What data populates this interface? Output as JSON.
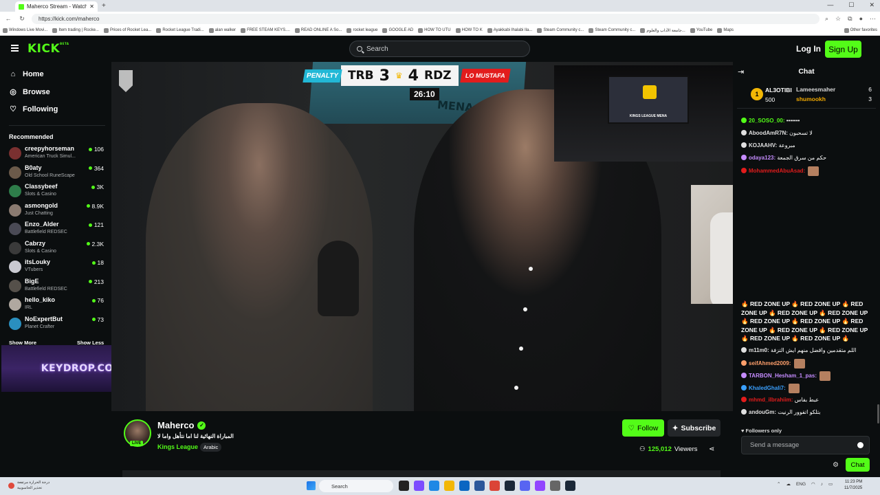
{
  "browser": {
    "tab_title": "Maherco Stream - Watch Li...",
    "url": "https://kick.com/maherco",
    "bookmarks": [
      "Windows Live Movi...",
      "Item trading | Rocke...",
      "Prices of Rocket Lea...",
      "Rocket League Tradi...",
      "alan walker",
      "FREE STEAM KEYS....",
      "READ ONLINE A So...",
      "rocket league",
      "GOOGLE AD",
      "HOW TO UTU",
      "HOW TO K",
      "Ayakkabi Ihalabi Ila...",
      "Steam Community c...",
      "Steam Community c...",
      "جامعة الآداب والعلوم...",
      "YouTube",
      "Maps"
    ],
    "other_bookmarks": "Other favorites"
  },
  "header": {
    "logo": "KICK",
    "logo_tag": "BETA",
    "search_placeholder": "Search",
    "login": "Log In",
    "signup": "Sign Up"
  },
  "sidebar": {
    "nav": [
      {
        "label": "Home",
        "icon": "home-icon"
      },
      {
        "label": "Browse",
        "icon": "compass-icon"
      },
      {
        "label": "Following",
        "icon": "heart-icon"
      }
    ],
    "recommended_title": "Recommended",
    "channels": [
      {
        "name": "creepyhorseman",
        "category": "American Truck Simul...",
        "viewers": "106",
        "color": "#7a3030"
      },
      {
        "name": "B0aty",
        "category": "Old School RuneScape",
        "viewers": "364",
        "color": "#6b5a4a"
      },
      {
        "name": "Classybeef",
        "category": "Slots & Casino",
        "viewers": "3K",
        "color": "#2e7d4a"
      },
      {
        "name": "asmongold",
        "category": "Just Chatting",
        "viewers": "8.9K",
        "color": "#8a7a70"
      },
      {
        "name": "Enzo_Alder",
        "category": "Battlefield REDSEC",
        "viewers": "121",
        "color": "#4a4a55"
      },
      {
        "name": "Cabrzy",
        "category": "Slots & Casino",
        "viewers": "2.3K",
        "color": "#3a3a3a"
      },
      {
        "name": "itsLouky",
        "category": "VTubers",
        "viewers": "18",
        "color": "#c9c9d1"
      },
      {
        "name": "BigE",
        "category": "Battlefield REDSEC",
        "viewers": "213",
        "color": "#55504a"
      },
      {
        "name": "hello_kiko",
        "category": "IRL",
        "viewers": "76",
        "color": "#b0a8a0"
      },
      {
        "name": "NoExpertBut",
        "category": "Planet Crafter",
        "viewers": "73",
        "color": "#2a8fbf"
      }
    ],
    "show_more": "Show More",
    "show_less": "Show Less",
    "ad_text": "KEYDROP.COM"
  },
  "video": {
    "penalty": "PENALTY",
    "team1": "TRB",
    "score1": "3",
    "score2": "4",
    "team2": "RDZ",
    "player_tag": "LO MUSTAFA",
    "clock": "26:10",
    "mena": "MENA",
    "pip_text": "KINGS LEAGUE MENA"
  },
  "stream": {
    "name": "Maherco",
    "live": "LIVE",
    "title": "المباراة النهائية لنا اما نتأهل واما لا",
    "category": "Kings League",
    "language": "Arabic",
    "follow": "Follow",
    "subscribe": "Subscribe",
    "viewers_count": "125,012",
    "viewers_label": "Viewers"
  },
  "chat": {
    "title": "Chat",
    "pinned": {
      "rank": "1",
      "user": "AL3OTIBI",
      "points": "500",
      "rows": [
        {
          "user": "Lameesmaher",
          "value": "6"
        },
        {
          "user": "shumookh",
          "value": "3"
        }
      ]
    },
    "messages": [
      {
        "user": "20_SOSO_00:",
        "text": "•••••••",
        "color": "#53fc18"
      },
      {
        "user": "AboodAmR7N:",
        "text": "لا تسحبون",
        "color": "#e0e0e0"
      },
      {
        "user": "KOJAAHV:",
        "text": "مبروعة",
        "color": "#e0e0e0"
      },
      {
        "user": "odaya123:",
        "text": "حكم من سرق الجمعة",
        "color": "#c58cff"
      },
      {
        "user": "MohammedAbuAsad:",
        "text": "",
        "color": "#e21c1c"
      },
      {
        "user": "m11m0:",
        "text": "اللم متقدمين واقضل منهم ايش التزفة",
        "color": "#e0e0e0"
      },
      {
        "user": "seifAhmed2009:",
        "text": "",
        "color": "#ff9f6b"
      },
      {
        "user": "TARBON_Hesham_1_pas:",
        "text": "",
        "color": "#c58cff"
      },
      {
        "user": "KhaledGhali7:",
        "text": "",
        "color": "#3aa0ff"
      },
      {
        "user": "mhmd_ilbrahiim:",
        "text": "عبط بفاس",
        "color": "#e21c1c"
      },
      {
        "user": "andouGm:",
        "text": "بتلكو اتفوور الرنيت",
        "color": "#e0e0e0"
      }
    ],
    "redzone": "🔥 RED ZONE UP 🔥 RED ZONE UP 🔥 RED ZONE UP 🔥 RED ZONE UP 🔥 RED ZONE UP 🔥 RED ZONE UP 🔥 RED ZONE UP 🔥 RED ZONE UP 🔥 RED ZONE UP 🔥 RED ZONE UP 🔥 RED ZONE UP 🔥 RED ZONE UP 🔥",
    "followers_only": "Followers only",
    "placeholder": "Send a message",
    "send": "Chat"
  },
  "taskbar": {
    "weather_line1": "درجة الحرارة مرتفعة",
    "weather_line2": "تحذير الحاسوبية",
    "search": "Search",
    "lang": "ENG",
    "time": "11:23 PM",
    "date": "11/7/2025"
  },
  "colors": {
    "brand": "#53fc18",
    "background": "#0b0e0f"
  }
}
